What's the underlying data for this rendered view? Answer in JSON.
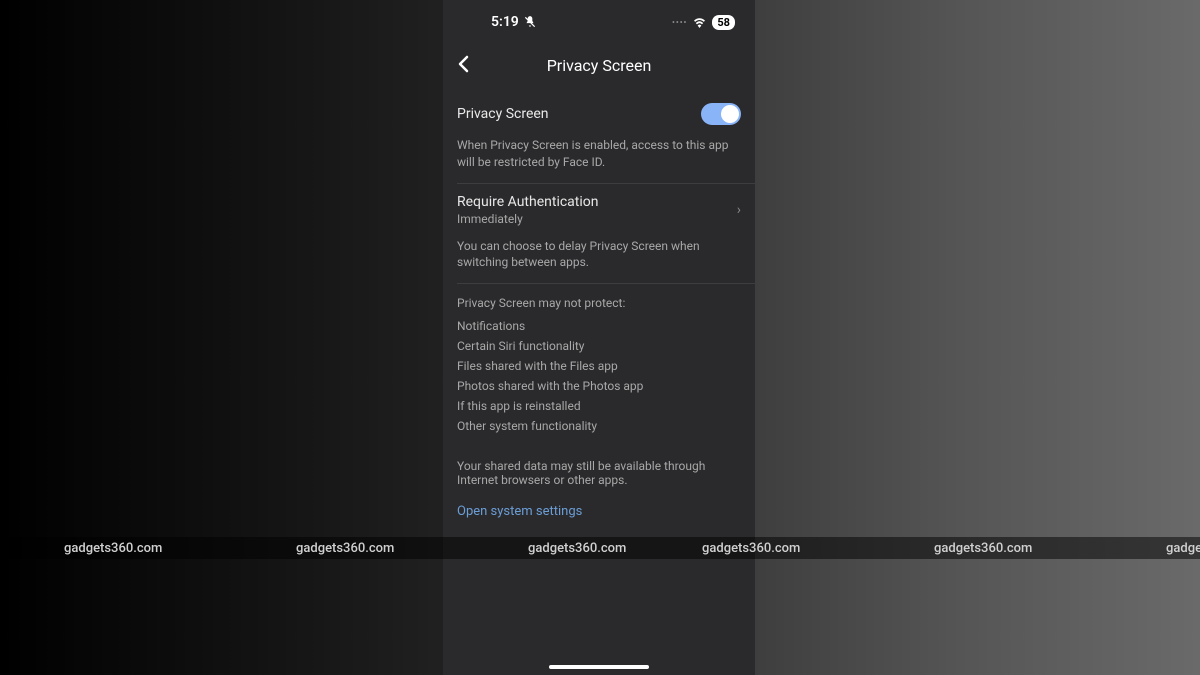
{
  "statusBar": {
    "time": "5:19",
    "battery": "58"
  },
  "header": {
    "title": "Privacy Screen"
  },
  "privacyToggle": {
    "label": "Privacy Screen",
    "description": "When Privacy Screen is enabled, access to this app will be restricted by Face ID."
  },
  "auth": {
    "title": "Require Authentication",
    "subtitle": "Immediately",
    "description": "You can choose to delay Privacy Screen when switching between apps."
  },
  "limitations": {
    "heading": "Privacy Screen may not protect:",
    "items": [
      "Notifications",
      "Certain Siri functionality",
      "Files shared with the Files app",
      "Photos shared with the Photos app",
      "If this app is reinstalled",
      "Other system functionality"
    ],
    "footer": "Your shared data may still be available through Internet browsers or other apps."
  },
  "link": {
    "label": "Open system settings"
  },
  "watermark": "gadgets360.com"
}
